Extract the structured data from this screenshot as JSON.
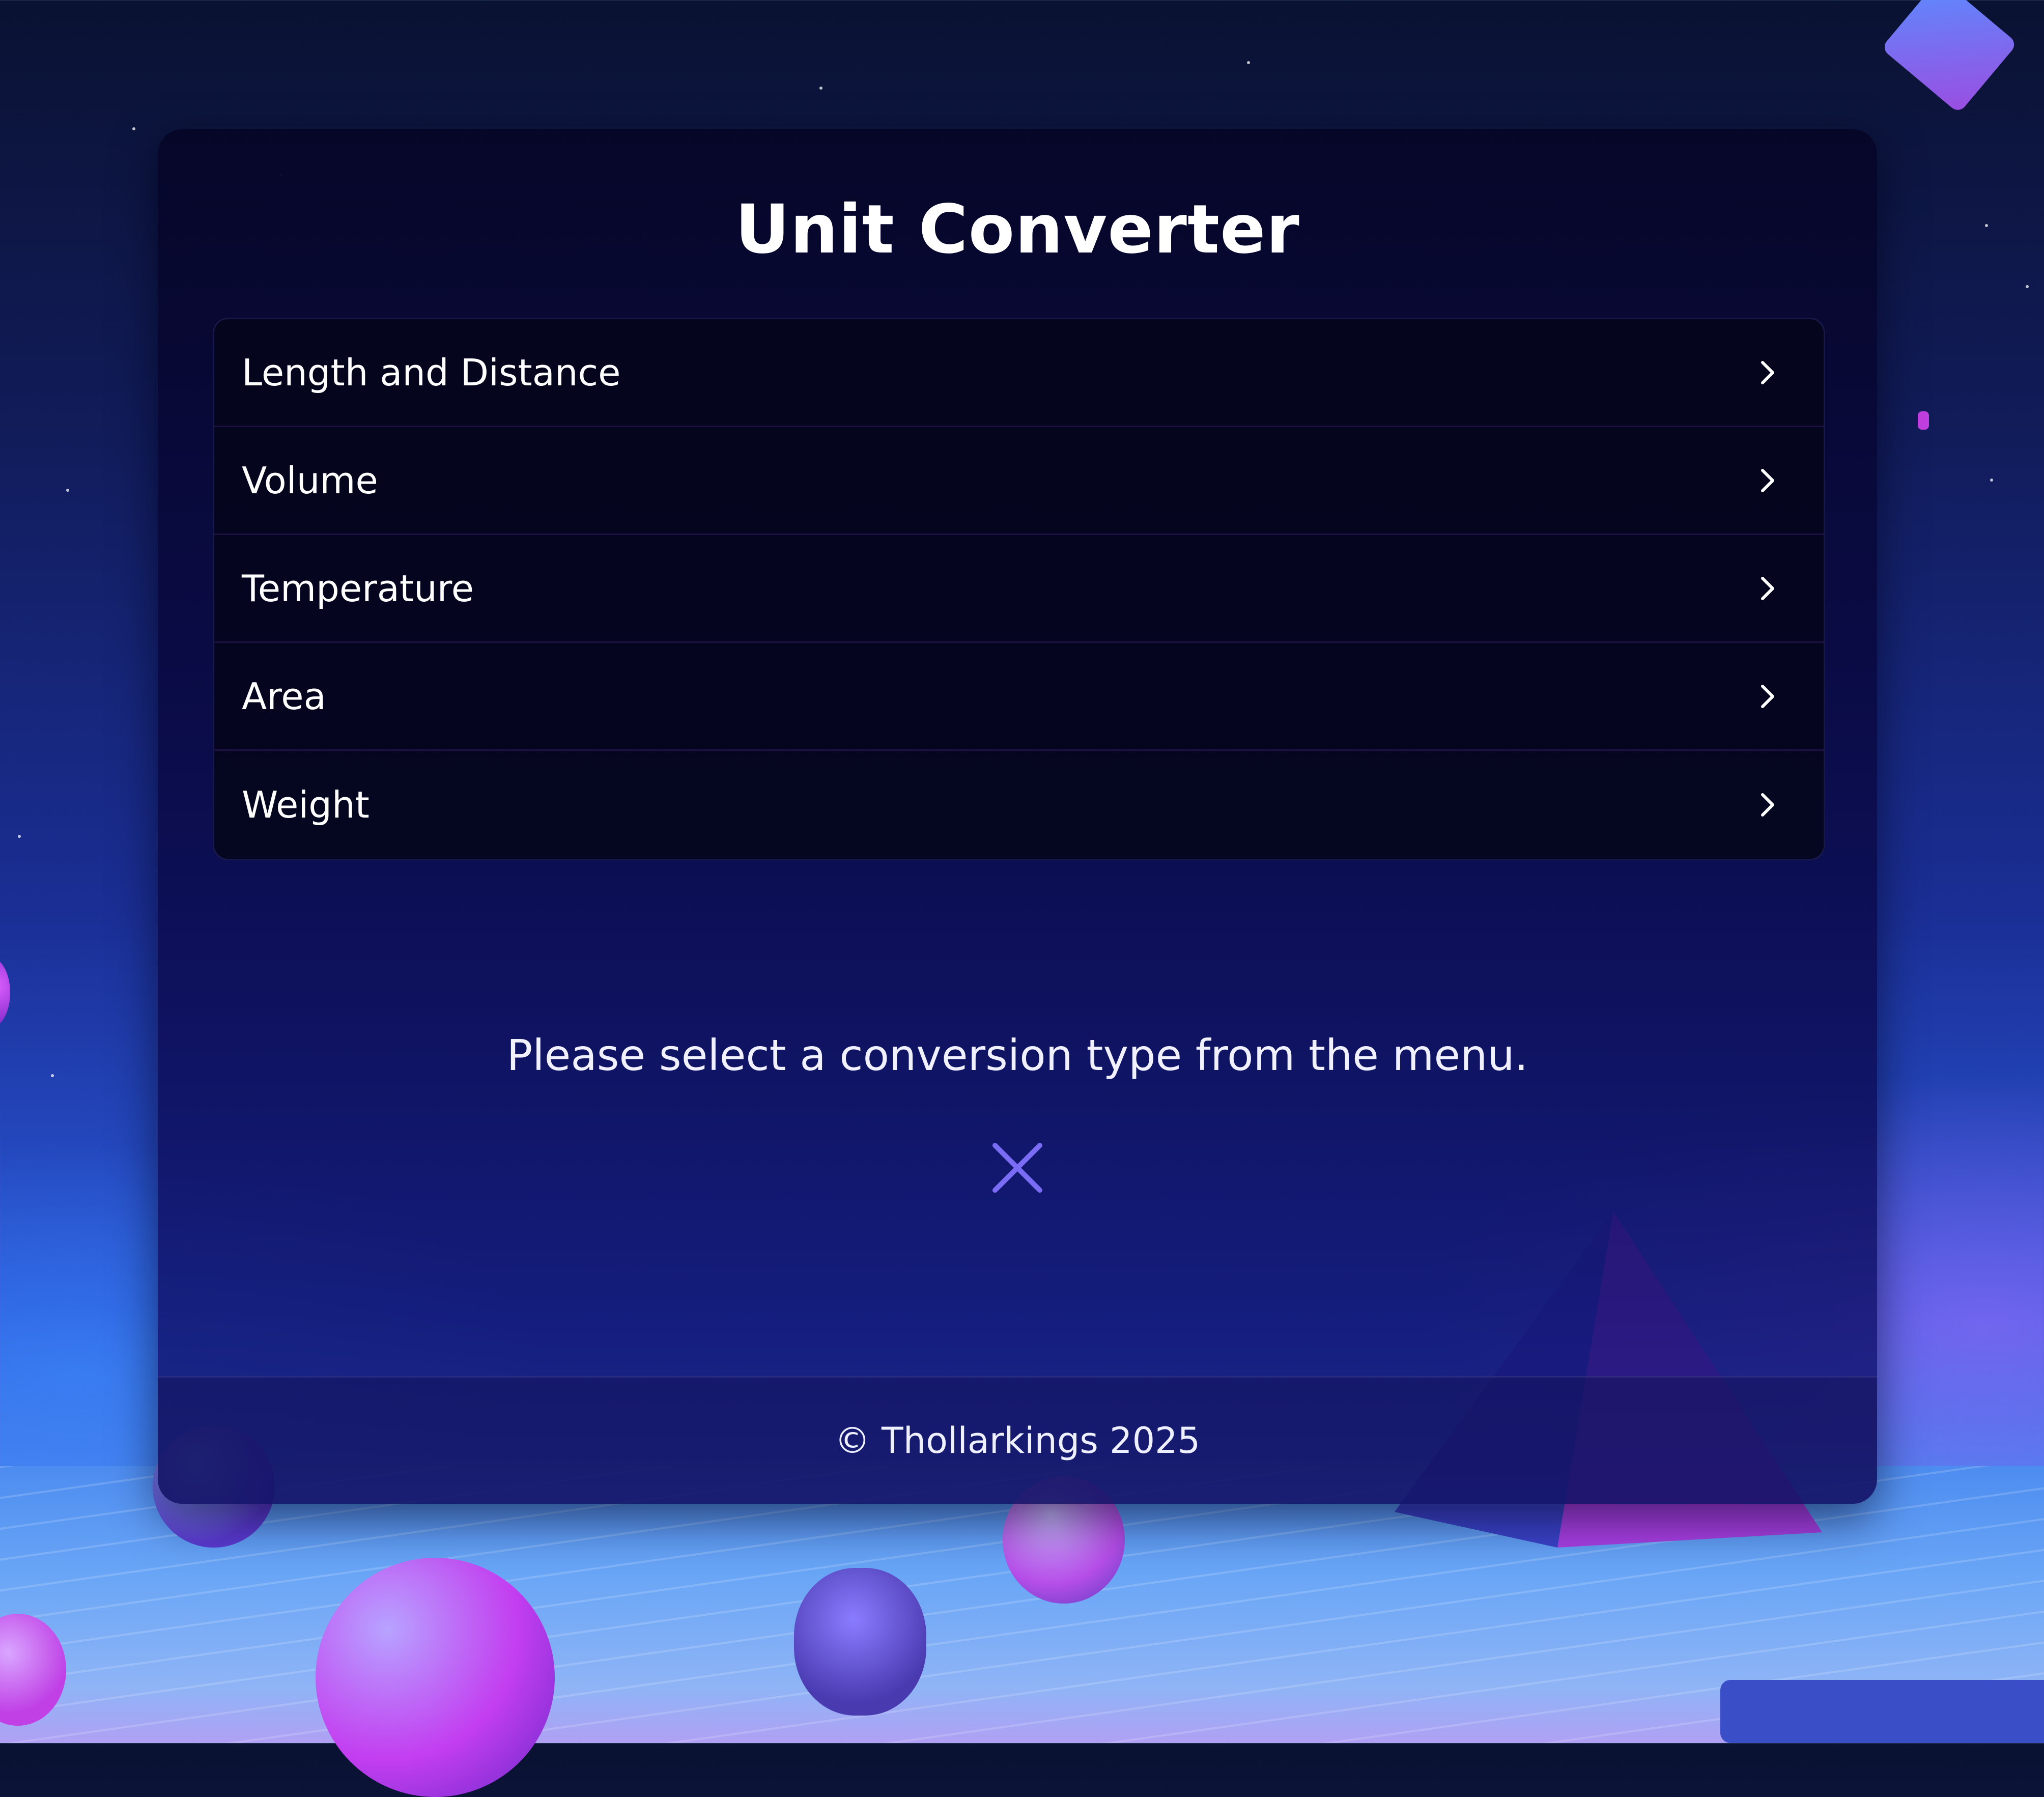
{
  "app": {
    "title": "Unit Converter",
    "menu": [
      {
        "label": "Length and Distance"
      },
      {
        "label": "Volume"
      },
      {
        "label": "Temperature"
      },
      {
        "label": "Area"
      },
      {
        "label": "Weight"
      }
    ],
    "message": "Please select a conversion type from the menu.",
    "close_icon": "close-icon",
    "footer": "© Thollarkings 2025"
  },
  "colors": {
    "accent": "#7b6cf6",
    "text": "#ffffff",
    "card": "#08083a"
  }
}
